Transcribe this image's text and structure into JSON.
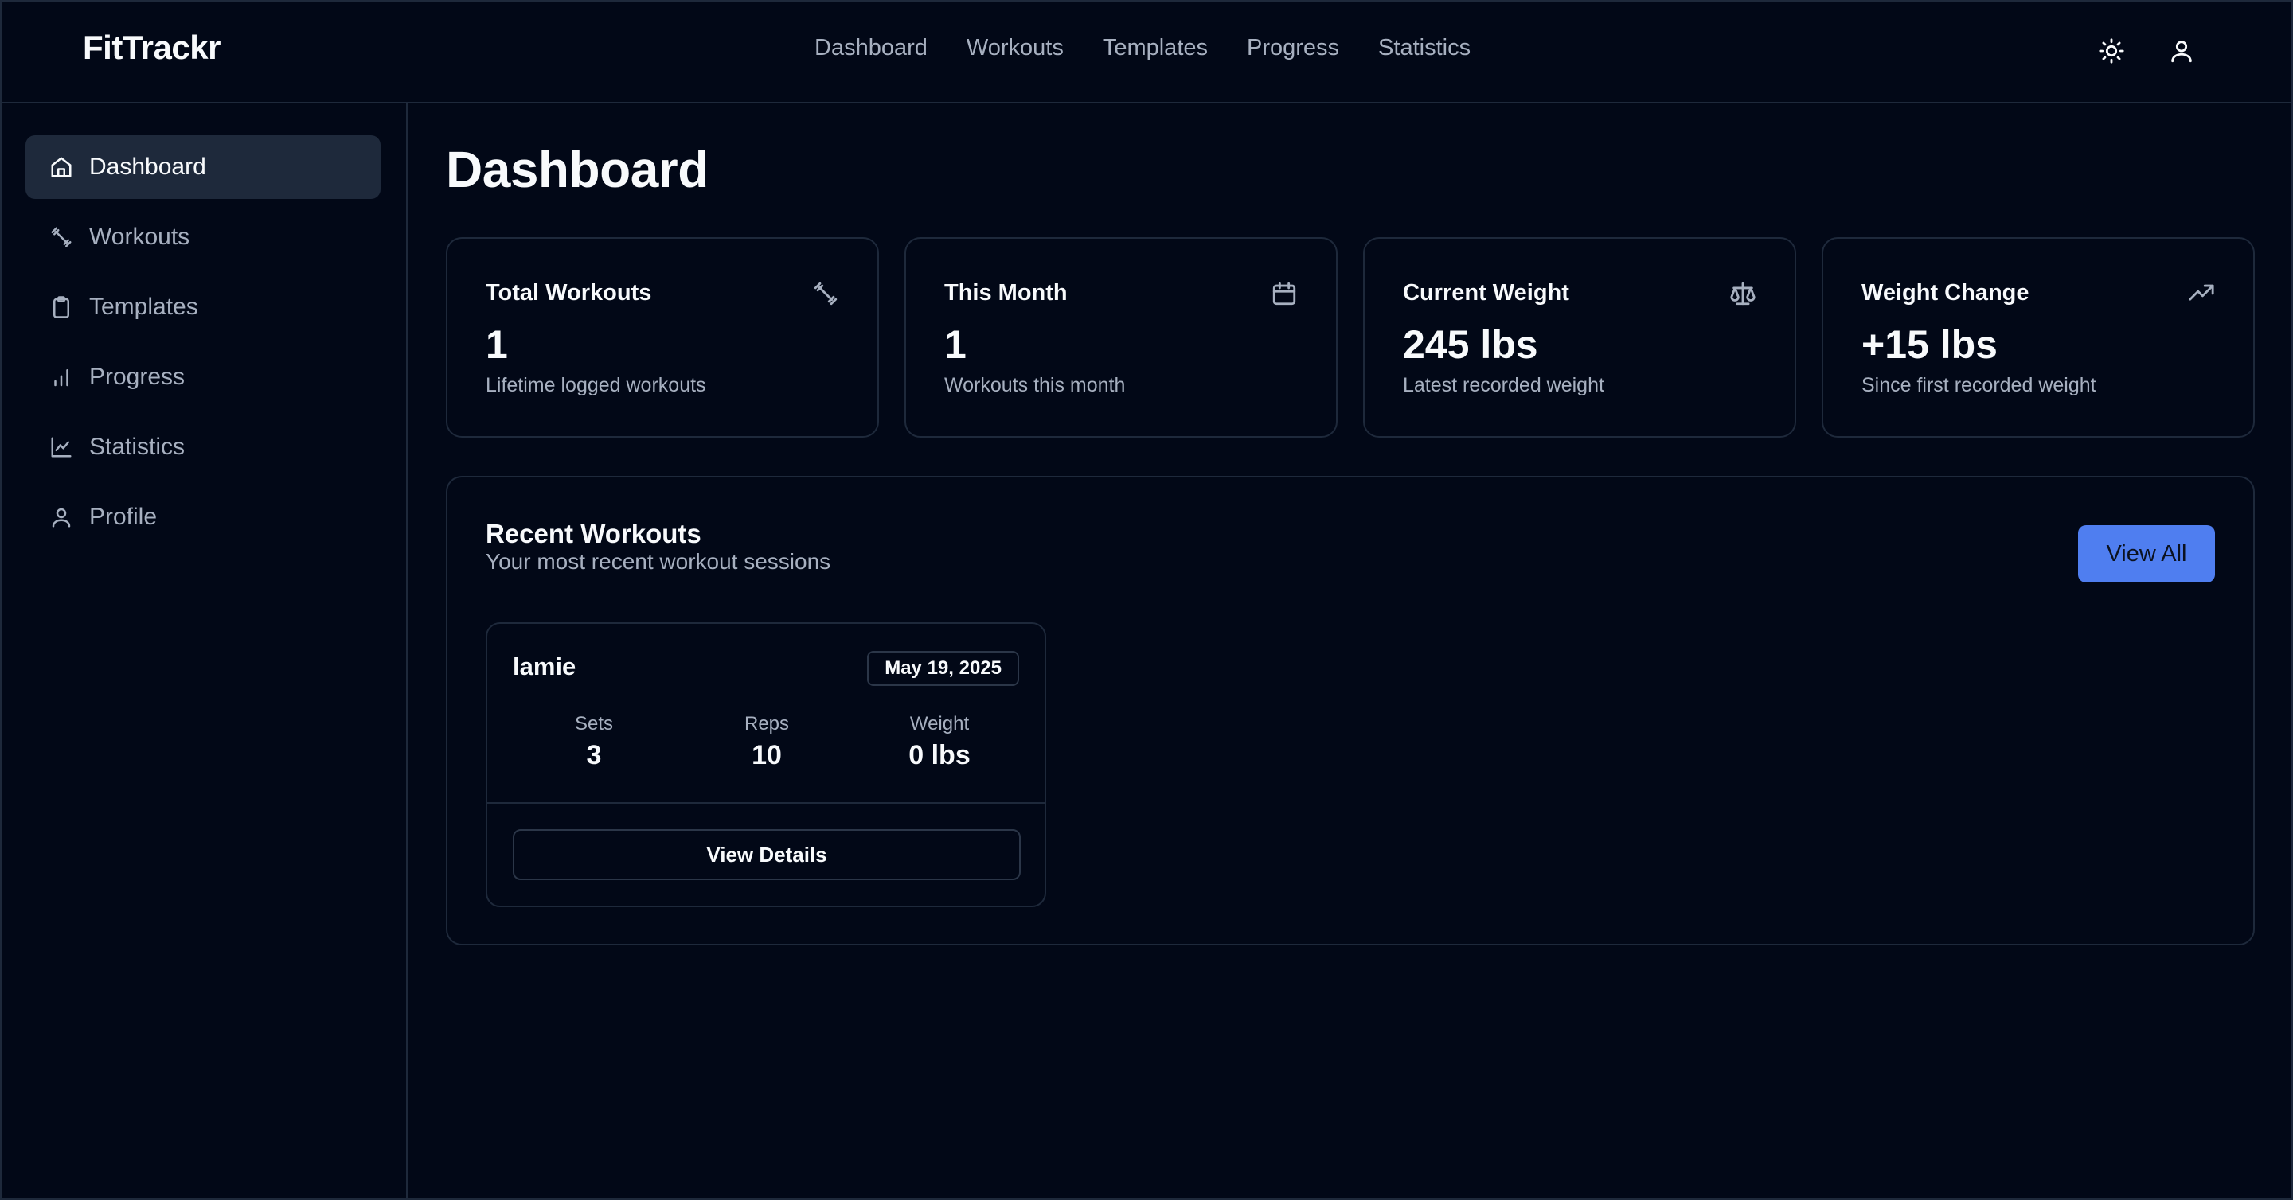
{
  "app": {
    "brand": "FitTrackr"
  },
  "topnav": {
    "items": [
      {
        "label": "Dashboard"
      },
      {
        "label": "Workouts"
      },
      {
        "label": "Templates"
      },
      {
        "label": "Progress"
      },
      {
        "label": "Statistics"
      }
    ],
    "icons": [
      "sun-icon",
      "user-icon"
    ]
  },
  "sidebar": {
    "items": [
      {
        "label": "Dashboard",
        "icon": "home-icon",
        "active": true
      },
      {
        "label": "Workouts",
        "icon": "dumbbell-icon"
      },
      {
        "label": "Templates",
        "icon": "clipboard-icon"
      },
      {
        "label": "Progress",
        "icon": "bar-chart-icon"
      },
      {
        "label": "Statistics",
        "icon": "line-chart-icon"
      },
      {
        "label": "Profile",
        "icon": "user-icon"
      }
    ]
  },
  "page": {
    "title": "Dashboard"
  },
  "stats": [
    {
      "label": "Total Workouts",
      "value": "1",
      "sub": "Lifetime logged workouts",
      "icon": "dumbbell-icon"
    },
    {
      "label": "This Month",
      "value": "1",
      "sub": "Workouts this month",
      "icon": "calendar-icon"
    },
    {
      "label": "Current Weight",
      "value": "245 lbs",
      "sub": "Latest recorded weight",
      "icon": "scale-icon"
    },
    {
      "label": "Weight Change",
      "value": "+15 lbs",
      "sub": "Since first recorded weight",
      "icon": "trending-up-icon"
    }
  ],
  "recent": {
    "title": "Recent Workouts",
    "subtitle": "Your most recent workout sessions",
    "view_all": "View All",
    "workouts": [
      {
        "name": "lamie",
        "date": "May 19, 2025",
        "metrics": [
          {
            "label": "Sets",
            "value": "3"
          },
          {
            "label": "Reps",
            "value": "10"
          },
          {
            "label": "Weight",
            "value": "0 lbs"
          }
        ],
        "details_label": "View Details"
      }
    ]
  },
  "colors": {
    "background": "#020817",
    "border": "#1e293b",
    "accent": "#4f7ef0",
    "muted_text": "#a7b0c0"
  }
}
